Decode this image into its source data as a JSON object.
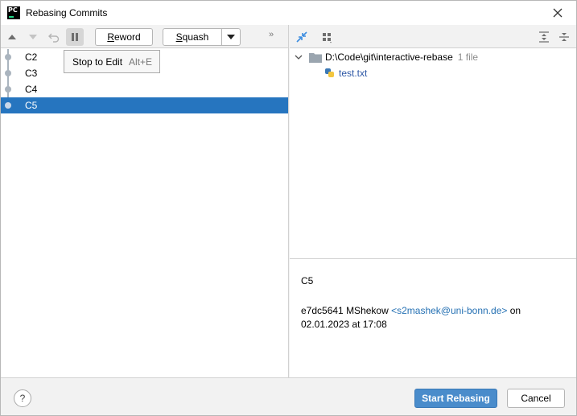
{
  "window": {
    "title": "Rebasing Commits",
    "app_icon_text": "PC",
    "icons": [
      "pycharm-app-icon",
      "close-icon"
    ]
  },
  "left_toolbar": {
    "icons": [
      "move-up-icon",
      "move-down-icon",
      "undo-icon",
      "pause-icon",
      "dropdown-arrow-icon",
      "more-actions-icon"
    ],
    "reword_label": "Reword",
    "reword_mnemonic": "R",
    "reword_rest": "eword",
    "squash_label": "Squash",
    "squash_mnemonic": "S",
    "squash_rest": "quash",
    "more_label": "»"
  },
  "tooltip": {
    "text": "Stop to Edit",
    "shortcut": "Alt+E"
  },
  "commits": [
    {
      "label": "C2",
      "selected": false
    },
    {
      "label": "C3",
      "selected": false
    },
    {
      "label": "C4",
      "selected": false
    },
    {
      "label": "C5",
      "selected": true
    }
  ],
  "right_toolbar": {
    "icons": [
      "show-diff-icon",
      "group-by-icon",
      "expand-all-icon",
      "collapse-all-icon"
    ]
  },
  "changes_tree": {
    "root_path": "D:\\Code\\git\\interactive-rebase",
    "root_count": "1 file",
    "files": [
      "test.txt"
    ]
  },
  "details": {
    "subject": "C5",
    "hash": "e7dc5641",
    "author": "MShekow",
    "email": "<s2mashek@uni-bonn.de>",
    "on_word": "on",
    "date": "02.01.2023 at 17:08"
  },
  "footer": {
    "help_label": "?",
    "primary_label": "Start Rebasing",
    "cancel_label": "Cancel"
  },
  "colors": {
    "selection": "#2675bf",
    "primary_button": "#4a8ccb",
    "link": "#2470b3",
    "file_name": "#2e58a6"
  }
}
